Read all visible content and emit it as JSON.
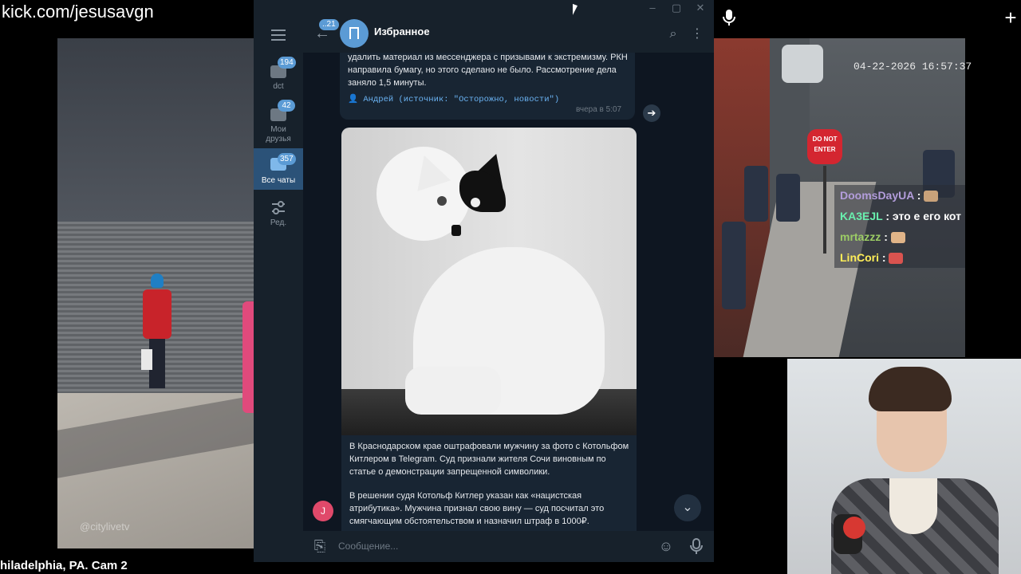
{
  "stream": {
    "url": "kick.com/jesusavgn",
    "camera_caption": "hiladelphia, PA. Cam 2",
    "timestamp": "04-22-2026 16:57:37",
    "watermark": "@citylivetv"
  },
  "stop_sign": {
    "line1": "DO NOT",
    "line2": "ENTER"
  },
  "stream_chat": [
    {
      "user": "DoomsDayUA",
      "color": "#b39ddb",
      "sep": " : ",
      "text": ""
    },
    {
      "user": "KA3EJL",
      "color": "#69f0ae",
      "sep": " : ",
      "text": "это е его кот"
    },
    {
      "user": "mrtazzz",
      "color": "#9ccc65",
      "sep": " : ",
      "text": ""
    },
    {
      "user": "LinCori",
      "color": "#ffee58",
      "sep": " : ",
      "text": ""
    }
  ],
  "telegram": {
    "window_controls": {
      "minimize": "–",
      "maximize": "▢",
      "close": "✕"
    },
    "folders": [
      {
        "label": "dct",
        "badge": "194"
      },
      {
        "label": "Мои друзья",
        "badge": "42"
      },
      {
        "label": "Все чаты",
        "badge": "357"
      },
      {
        "label": "Ред.",
        "badge": ""
      }
    ],
    "header": {
      "back_badge": "..21",
      "title": "Избранное"
    },
    "messages": {
      "prev_text": "удалить материал из мессенджера с призывами к экстремизму. РКН направила бумагу, но этого сделано не было. Рассмотрение дела заняло 1,5 минуты.",
      "prev_source": "👤 Андрей (источник: \"Осторожно, новости\")",
      "prev_time": "вчера в 5:07",
      "main_p1": "В Краснодарском крае оштрафовали мужчину за фото с Котольфом Китлером в Telegram. Суд признали жителя Сочи виновным по статье о демонстрации запрещенной символики.",
      "main_p2": "В решении судя Котольф Китлер указан как «нацистская атрибутика». Мужчина признал свою вину — суд посчитал это смягчающим обстоятельством и назначил штраф в 1000₽.",
      "sender_initial": "J"
    },
    "input": {
      "placeholder": "Сообщение..."
    }
  },
  "colors": {
    "accent": "#5b9bd5",
    "bg": "#0e1621",
    "panel": "#17212b",
    "bubble": "#182533"
  }
}
